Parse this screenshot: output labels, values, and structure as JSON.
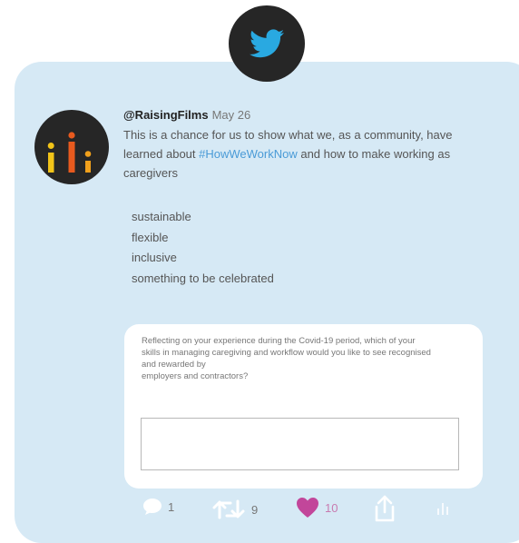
{
  "colors": {
    "card_background": "#d6e9f5",
    "twitter_blue": "#29a9e1",
    "badge_background": "#262626",
    "hashtag": "#4a9bd7",
    "like": "#c2469a"
  },
  "header": {
    "icon": "twitter-bird-icon"
  },
  "tweet": {
    "handle": "@RaisingFilms",
    "date": "May 26",
    "text_before": "This is a chance for us to show what we, as a community, have learned about ",
    "hashtag": "#HowWeWorkNow",
    "text_after": " and how to make working as caregivers",
    "list": [
      "sustainable",
      "flexible",
      "inclusive",
      "something to be celebrated"
    ]
  },
  "survey": {
    "question_line1": "Reflecting on your experience during the Covid-19 period, which of your",
    "question_line2": "skills in managing caregiving and workflow would you like to see recognised",
    "question_line3": "and rewarded by",
    "question_line4": "employers and contractors?",
    "answer_value": ""
  },
  "actions": {
    "reply_count": "1",
    "retweet_count": "9",
    "like_count": "10"
  }
}
